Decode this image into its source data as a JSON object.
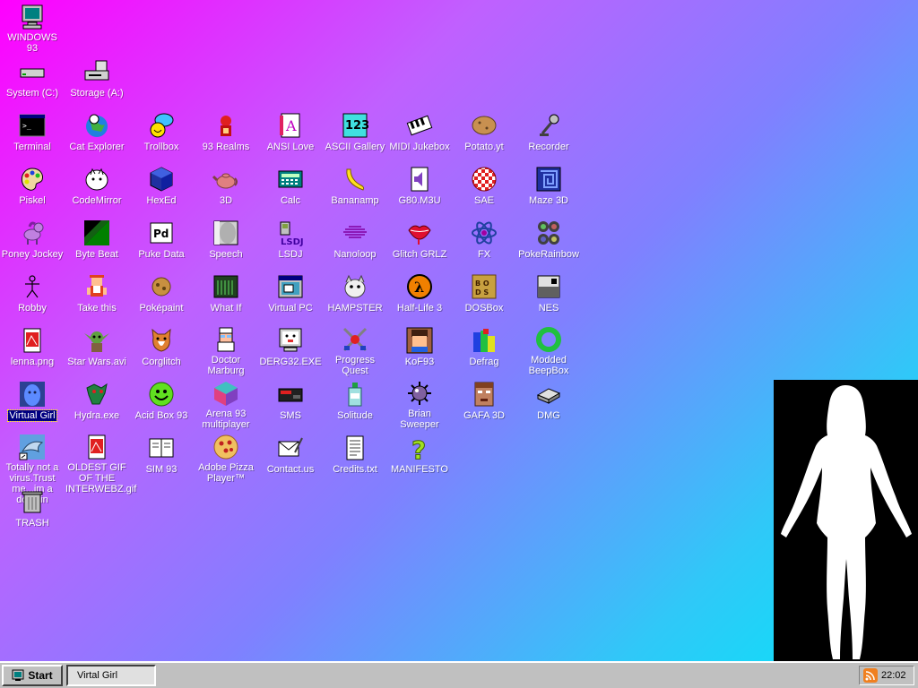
{
  "desktop": {
    "icons": [
      {
        "label": "WINDOWS 93",
        "icon": "computer-icon"
      },
      {
        "label": "System (C:)",
        "icon": "drive-icon"
      },
      {
        "label": "Storage (A:)",
        "icon": "floppy-drive-icon"
      },
      {
        "label": "Terminal",
        "icon": "terminal-icon"
      },
      {
        "label": "Cat Explorer",
        "icon": "cat-globe-icon"
      },
      {
        "label": "Trollbox",
        "icon": "chat-bubble-icon"
      },
      {
        "label": "93 Realms",
        "icon": "realms-icon"
      },
      {
        "label": "ANSI Love",
        "icon": "ansi-icon"
      },
      {
        "label": "ASCII Gallery",
        "icon": "ascii-icon"
      },
      {
        "label": "MIDI Jukebox",
        "icon": "piano-icon"
      },
      {
        "label": "Potato.yt",
        "icon": "potato-icon"
      },
      {
        "label": "Recorder",
        "icon": "microphone-icon"
      },
      {
        "label": "Piskel",
        "icon": "palette-icon"
      },
      {
        "label": "CodeMirror",
        "icon": "cat-mirror-icon"
      },
      {
        "label": "HexEd",
        "icon": "cube-icon"
      },
      {
        "label": "3D",
        "icon": "teapot-icon"
      },
      {
        "label": "Calc",
        "icon": "calculator-icon"
      },
      {
        "label": "Bananamp",
        "icon": "banana-icon"
      },
      {
        "label": "G80.M3U",
        "icon": "audio-file-icon"
      },
      {
        "label": "SAE",
        "icon": "amiga-ball-icon"
      },
      {
        "label": "Maze 3D",
        "icon": "maze-icon"
      },
      {
        "label": "Poney Jockey",
        "icon": "pony-icon"
      },
      {
        "label": "Byte Beat",
        "icon": "bytebeat-icon"
      },
      {
        "label": "Puke Data",
        "icon": "pd-icon"
      },
      {
        "label": "Speech",
        "icon": "face-icon"
      },
      {
        "label": "LSDJ",
        "icon": "gameboy-icon"
      },
      {
        "label": "Nanoloop",
        "icon": "wave-icon"
      },
      {
        "label": "Glitch GRLZ",
        "icon": "lips-icon"
      },
      {
        "label": "FX",
        "icon": "atom-icon"
      },
      {
        "label": "PokeRainbow",
        "icon": "pokerainbow-icon"
      },
      {
        "label": "Robby",
        "icon": "stick-figure-icon"
      },
      {
        "label": "Take this",
        "icon": "take-this-icon"
      },
      {
        "label": "Poképaint",
        "icon": "pokepaint-icon"
      },
      {
        "label": "What If",
        "icon": "what-if-icon"
      },
      {
        "label": "Virtual PC",
        "icon": "window-icon"
      },
      {
        "label": "HAMPSTER",
        "icon": "hamster-icon"
      },
      {
        "label": "Half-Life 3",
        "icon": "lambda-icon"
      },
      {
        "label": "DOSBox",
        "icon": "dosbox-icon"
      },
      {
        "label": "NES",
        "icon": "nes-icon"
      },
      {
        "label": "lenna.png",
        "icon": "image-file-icon"
      },
      {
        "label": "Star Wars.avi",
        "icon": "yoda-icon"
      },
      {
        "label": "Corglitch",
        "icon": "corgi-icon"
      },
      {
        "label": "Doctor Marburg",
        "icon": "doctor-icon"
      },
      {
        "label": "DERG32.EXE",
        "icon": "monitor-face-icon"
      },
      {
        "label": "Progress Quest",
        "icon": "swords-icon"
      },
      {
        "label": "KoF93",
        "icon": "fighter-icon"
      },
      {
        "label": "Defrag",
        "icon": "defrag-icon"
      },
      {
        "label": "Modded BeepBox",
        "icon": "ring-icon"
      },
      {
        "label": "Virtual Girl",
        "icon": "blue-face-icon"
      },
      {
        "label": "Hydra.exe",
        "icon": "dragon-icon"
      },
      {
        "label": "Acid Box 93",
        "icon": "smiley-icon"
      },
      {
        "label": "Arena 93 multiplayer",
        "icon": "arena-cube-icon"
      },
      {
        "label": "SMS",
        "icon": "sms-console-icon"
      },
      {
        "label": "Solitude",
        "icon": "bottle-icon"
      },
      {
        "label": "Brian Sweeper",
        "icon": "mine-icon"
      },
      {
        "label": "GAFA 3D",
        "icon": "doom-face-icon"
      },
      {
        "label": "DMG",
        "icon": "dmg-icon"
      },
      {
        "label": "Totally not a virus.Trust me...im a dolphin",
        "icon": "dolphin-icon"
      },
      {
        "label": "OLDEST GIF OF THE INTERWEBZ.gif",
        "icon": "gif-file-icon"
      },
      {
        "label": "SIM 93",
        "icon": "book-icon"
      },
      {
        "label": "Adobe Pizza Player™",
        "icon": "pizza-icon"
      },
      {
        "label": "Contact.us",
        "icon": "mail-icon"
      },
      {
        "label": "Credits.txt",
        "icon": "text-file-icon"
      },
      {
        "label": "MANIFESTO",
        "icon": "question-icon"
      },
      {
        "label": "TRASH",
        "icon": "trash-icon"
      }
    ]
  },
  "taskbar": {
    "start_label": "Start",
    "task_label": "Virtal Girl",
    "clock": "22:02"
  },
  "colors": {
    "gradient_start": "#ff00ff",
    "gradient_end": "#00e8f8",
    "taskbar": "#c0c0c0",
    "selection": "#000080"
  }
}
